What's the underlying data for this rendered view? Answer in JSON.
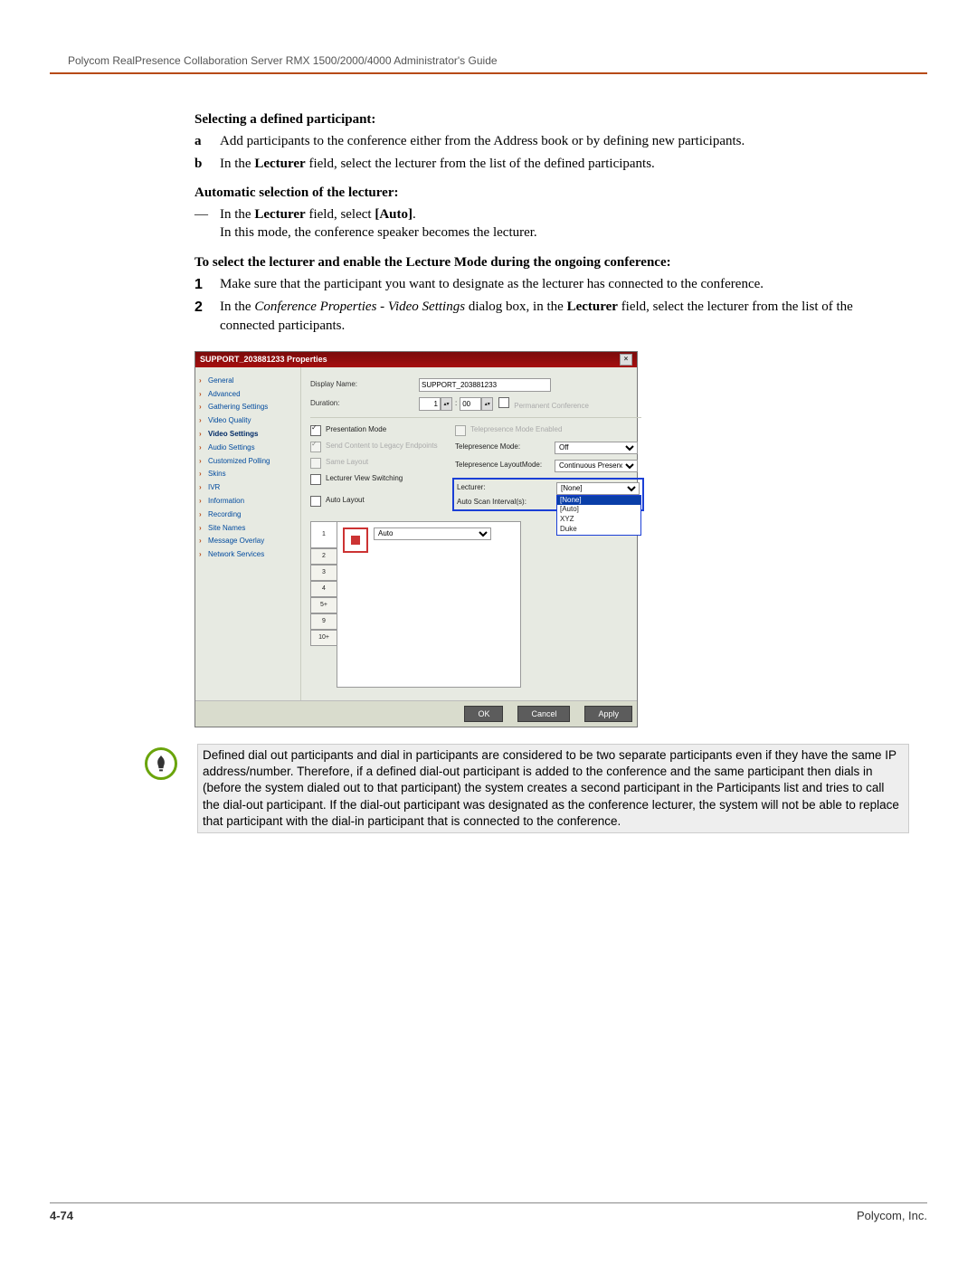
{
  "header": "Polycom RealPresence Collaboration Server RMX 1500/2000/4000 Administrator's Guide",
  "s1_title": "Selecting a defined participant:",
  "s1_a_m": "a",
  "s1_a": "Add participants to the conference either from the Address book or by defining new participants.",
  "s1_b_m": "b",
  "s1_b_pre": "In the ",
  "s1_b_bold": "Lecturer",
  "s1_b_post": " field, select the lecturer from the list of the defined participants.",
  "s2_title": "Automatic selection of the lecturer:",
  "s2_dash": "—",
  "s2_a_pre": "In the ",
  "s2_a_bold1": "Lecturer",
  "s2_a_mid": " field, select ",
  "s2_a_bold2": "[Auto]",
  "s2_a_post": ".",
  "s2_b": "In this mode, the conference speaker becomes the lecturer.",
  "s3_title": "To select the lecturer and enable the Lecture Mode during the ongoing conference:",
  "s3_1_m": "1",
  "s3_1": "Make sure that the participant you want to designate as the lecturer has connected to the conference.",
  "s3_2_m": "2",
  "s3_2_pre": "In the ",
  "s3_2_it": "Conference Properties - Video Settings",
  "s3_2_mid": " dialog box, in the ",
  "s3_2_bold": "Lecturer",
  "s3_2_post": " field, select the lecturer from the list of the connected participants.",
  "dlg": {
    "title": "SUPPORT_203881233 Properties",
    "nav": [
      "General",
      "Advanced",
      "Gathering Settings",
      "Video Quality",
      "Video Settings",
      "Audio Settings",
      "Customized Polling",
      "Skins",
      "IVR",
      "Information",
      "Recording",
      "Site Names",
      "Message Overlay",
      "Network Services"
    ],
    "nav_active": "Video Settings",
    "display_name_lbl": "Display Name:",
    "display_name_val": "SUPPORT_203881233",
    "duration_lbl": "Duration:",
    "dur_h": "1",
    "dur_sep": ":",
    "dur_m": "00",
    "perm_conf": "Permanent Conference",
    "presentation_mode": "Presentation Mode",
    "send_legacy": "Send Content to Legacy Endpoints",
    "same_layout": "Same Layout",
    "lvs": "Lecturer View Switching",
    "auto_layout": "Auto Layout",
    "tp_enabled": "Telepresence Mode Enabled",
    "tp_mode_lbl": "Telepresence Mode:",
    "tp_mode_val": "Off",
    "tp_layout_lbl": "Telepresence LayoutMode:",
    "tp_layout_val": "Continuous Presence",
    "lecturer_lbl": "Lecturer:",
    "lecturer_val": "[None]",
    "lecturer_opts": [
      "[None]",
      "[Auto]",
      "XYZ",
      "Duke"
    ],
    "auto_scan_lbl": "Auto Scan Interval(s):",
    "layout_tabs": [
      "1",
      "2",
      "3",
      "4",
      "5+",
      "9",
      "10+"
    ],
    "layout_sel": "Auto",
    "btn_ok": "OK",
    "btn_cancel": "Cancel",
    "btn_apply": "Apply"
  },
  "note": "Defined dial out participants and dial in participants are considered to be two separate participants even if they have the same IP address/number. Therefore, if a defined dial-out participant is added to the conference and the same participant then dials in (before the system dialed out to that participant) the system creates a second participant in the Participants list and tries to call the dial-out participant. If the dial-out participant was designated as the conference lecturer, the system will not be able to replace that participant with the dial-in participant that is connected to the conference.",
  "footer_page": "4-74",
  "footer_right": "Polycom, Inc."
}
